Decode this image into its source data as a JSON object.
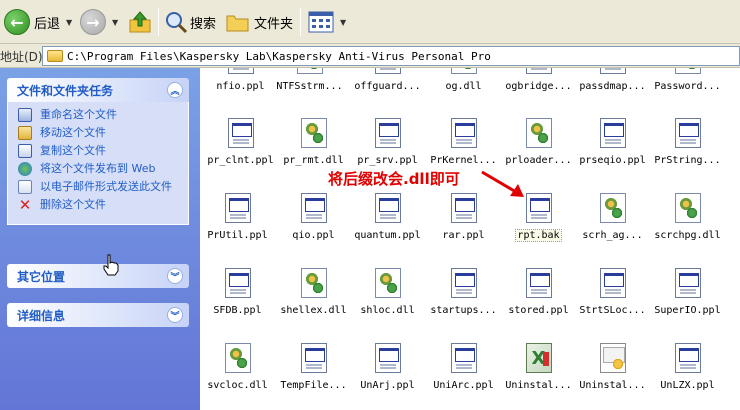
{
  "toolbar": {
    "back_label": "后退",
    "search_label": "搜索",
    "folders_label": "文件夹"
  },
  "address": {
    "label": "地址(D)",
    "path": "C:\\Program Files\\Kaspersky Lab\\Kaspersky Anti-Virus Personal Pro"
  },
  "left_panel": {
    "file_tasks": {
      "title": "文件和文件夹任务",
      "items": [
        "重命名这个文件",
        "移动这个文件",
        "复制这个文件",
        "将这个文件发布到 Web",
        "以电子邮件形式发送此文件",
        "删除这个文件"
      ]
    },
    "other_places": {
      "title": "其它位置"
    },
    "details": {
      "title": "详细信息"
    }
  },
  "annotation": "将后缀改会.dll即可",
  "files": {
    "row0": [
      "nfio.ppl",
      "NTFSstrm...",
      "offguard...",
      "og.dll",
      "ogbridge...",
      "passdmap...",
      "Password..."
    ],
    "row1": [
      "pr_clnt.ppl",
      "pr_rmt.dll",
      "pr_srv.ppl",
      "PrKernel...",
      "prloader...",
      "prseqio.ppl",
      "PrString..."
    ],
    "row2": [
      "PrUtil.ppl",
      "qio.ppl",
      "quantum.ppl",
      "rar.ppl",
      "rpt.bak",
      "scrh_ag...",
      "scrchpg.dll"
    ],
    "row3": [
      "SFDB.ppl",
      "shellex.dll",
      "shloc.dll",
      "startups...",
      "stored.ppl",
      "StrtSLoc...",
      "SuperIO.ppl"
    ],
    "row4": [
      "svcloc.dll",
      "TempFile...",
      "UnArj.ppl",
      "UniArc.ppl",
      "Uninstal...",
      "Uninstal...",
      "UnLZX.ppl"
    ]
  }
}
